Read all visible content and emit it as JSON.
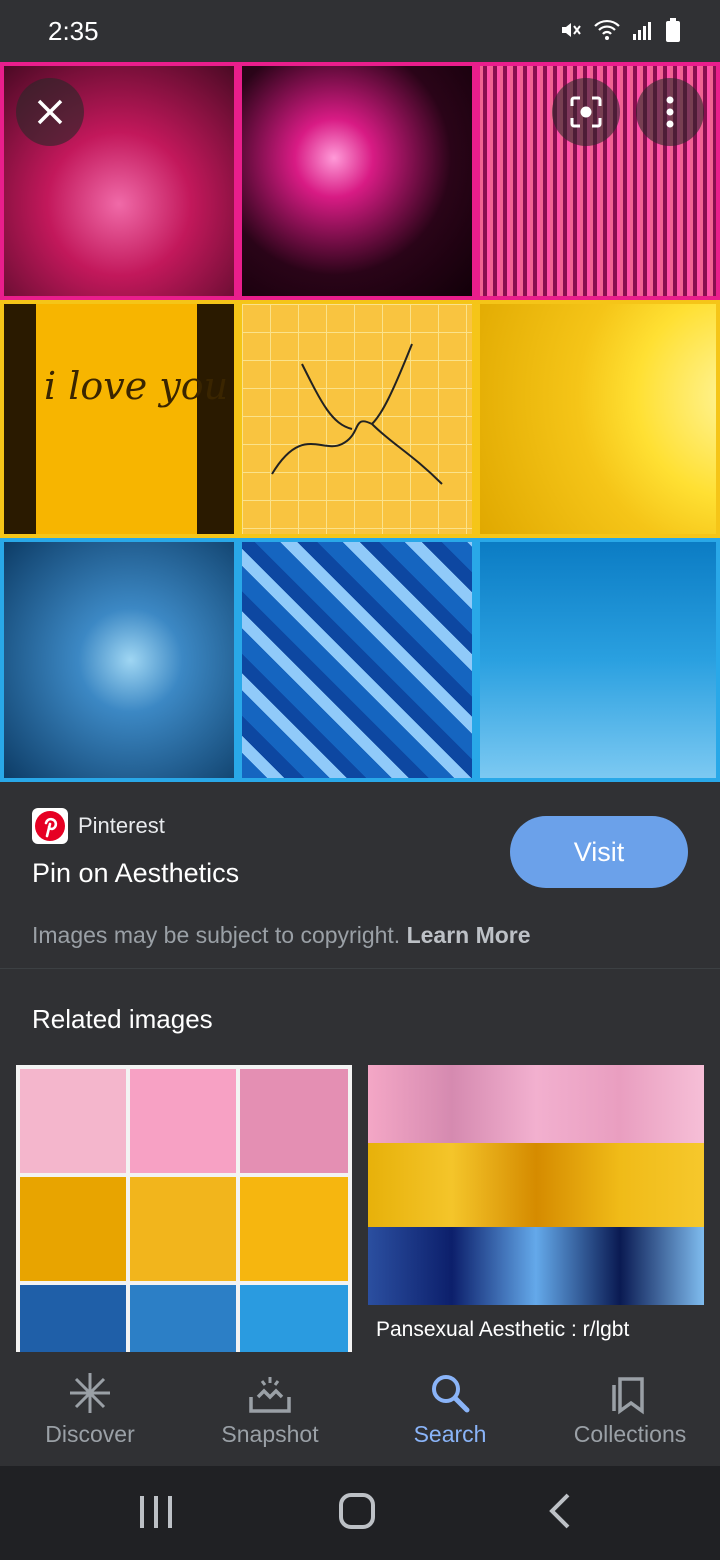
{
  "status": {
    "time": "2:35"
  },
  "hero": {
    "close_icon": "close-icon",
    "lens_icon": "lens-icon",
    "more_icon": "more-vert-icon",
    "tile_text": "i love you"
  },
  "result": {
    "source": "Pinterest",
    "title": "Pin on Aesthetics",
    "visit_label": "Visit",
    "copyright_text": "Images may be subject to copyright.",
    "learn_more": "Learn More"
  },
  "related": {
    "heading": "Related images",
    "items": [
      {
        "caption": ""
      },
      {
        "caption": "Pansexual Aesthetic : r/lgbt"
      }
    ]
  },
  "bottom_nav": {
    "items": [
      {
        "label": "Discover",
        "icon": "discover-icon"
      },
      {
        "label": "Snapshot",
        "icon": "snapshot-icon"
      },
      {
        "label": "Search",
        "icon": "search-icon"
      },
      {
        "label": "Collections",
        "icon": "collections-icon"
      }
    ]
  },
  "colors": {
    "accent": "#8ab4f8",
    "visit": "#6ba1ea",
    "pink": "#e91e8c",
    "yellow": "#f5c518",
    "blue": "#29a8e8"
  }
}
